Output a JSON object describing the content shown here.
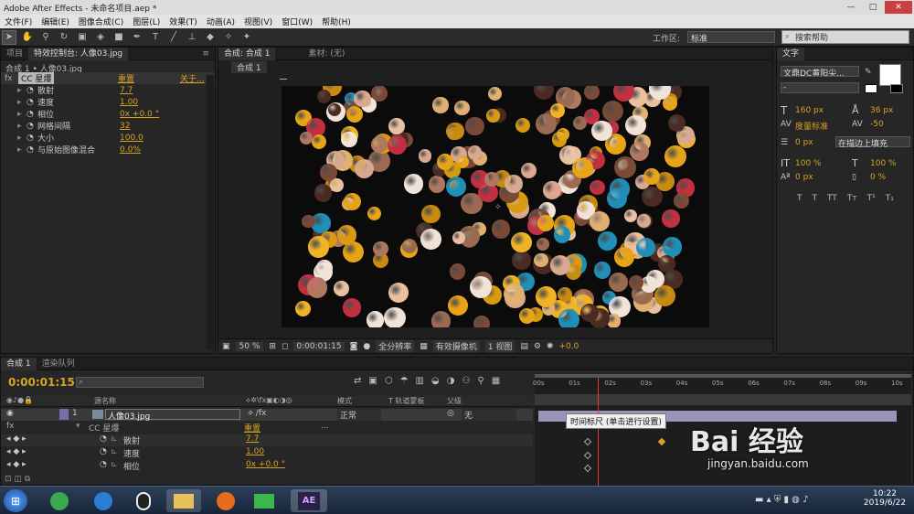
{
  "window": {
    "title": "Adobe After Effects - 未命名项目.aep *",
    "minimize": "—",
    "maximize": "□",
    "close": "✕"
  },
  "menu": [
    "文件(F)",
    "编辑(E)",
    "图像合成(C)",
    "图层(L)",
    "效果(T)",
    "动画(A)",
    "视图(V)",
    "窗口(W)",
    "帮助(H)"
  ],
  "toolbar": {
    "tools": [
      "selection-tool-icon",
      "hand-tool-icon",
      "zoom-tool-icon",
      "rotate-tool-icon",
      "camera-tool-icon",
      "pan-behind-tool-icon",
      "rectangle-tool-icon",
      "pen-tool-icon",
      "text-tool-icon",
      "brush-tool-icon",
      "clone-tool-icon",
      "eraser-tool-icon",
      "roto-brush-tool-icon",
      "puppet-tool-icon"
    ],
    "workspace_label": "工作区:",
    "workspace_value": "标准",
    "search_help": "搜索帮助"
  },
  "effect_panel": {
    "tabs": [
      "项目",
      "特效控制台: 人像03.jpg",
      "≡"
    ],
    "breadcrumb": "合成 1 • 人像03.jpg",
    "effect_name": "CC 星爆",
    "reset": "重置",
    "about": "关于...",
    "properties": [
      {
        "name": "散射",
        "value": "7.7"
      },
      {
        "name": "速度",
        "value": "1.00"
      },
      {
        "name": "相位",
        "value": "0x +0.0 °"
      },
      {
        "name": "网格间隔",
        "value": "32"
      },
      {
        "name": "大小",
        "value": "100.0"
      },
      {
        "name": "与原始图像混合",
        "value": "0.0%"
      }
    ]
  },
  "comp_panel": {
    "tabs": [
      "合成: 合成 1",
      "素材: (无)"
    ],
    "sub_tab": "合成 1",
    "footer": {
      "zoom": "50 %",
      "timecode": "0:00:01:15",
      "resolution": "全分辨率",
      "camera": "有效摄像机",
      "views": "1 视图",
      "exposure": "+0.0"
    }
  },
  "text_panel": {
    "tab": "文字",
    "font": "文鼎DC黄阳尖...",
    "style": "-",
    "size": "160 px",
    "leading": "36 px",
    "kerning": "度量标准",
    "tracking": "-50",
    "stroke_width": "0 px",
    "stroke_mode": "在描边上填充",
    "vscale": "100 %",
    "hscale": "100 %",
    "baseline": "0 px",
    "tsume": "0 %",
    "style_buttons": [
      "T",
      "T",
      "TT",
      "Tт",
      "T¹",
      "T₁"
    ]
  },
  "timeline": {
    "tabs": [
      "合成 1",
      "渲染队列"
    ],
    "timecode": "0:00:01:15",
    "search_placeholder": "",
    "col_headers": {
      "source": "源名称",
      "mode": "模式",
      "track": "T  轨道蒙板",
      "parent": "父级"
    },
    "ruler": [
      "00s",
      "01s",
      "02s",
      "03s",
      "04s",
      "05s",
      "06s",
      "07s",
      "08s",
      "09s",
      "10s"
    ],
    "layer": {
      "index": "1",
      "name": "人像03.jpg",
      "mode": "正常",
      "parent": "无"
    },
    "effect": {
      "name": "CC 星爆",
      "reset": "重置",
      "ellipsis": "..."
    },
    "props": [
      {
        "name": "散射",
        "value": "7.7"
      },
      {
        "name": "速度",
        "value": "1.00"
      },
      {
        "name": "相位",
        "value": "0x +0.0 °"
      }
    ],
    "tooltip": "时间标尺 (单击进行设置)",
    "playhead_frac": 0.165,
    "work_area_start": "0s"
  },
  "watermark": {
    "brand": "Bai 经验",
    "url": "jingyan.baidu.com"
  },
  "taskbar": {
    "time": "10:22",
    "date": "2019/6/22",
    "apps": [
      "start-orb-icon",
      "browser-360-icon",
      "ie-icon",
      "qq-icon",
      "file-explorer-icon",
      "firefox-icon",
      "media-player-icon",
      "after-effects-icon"
    ],
    "ae_label": "AE"
  },
  "colors": {
    "accent": "#d8a324",
    "panel": "#262626",
    "playhead": "#e23a3a"
  }
}
